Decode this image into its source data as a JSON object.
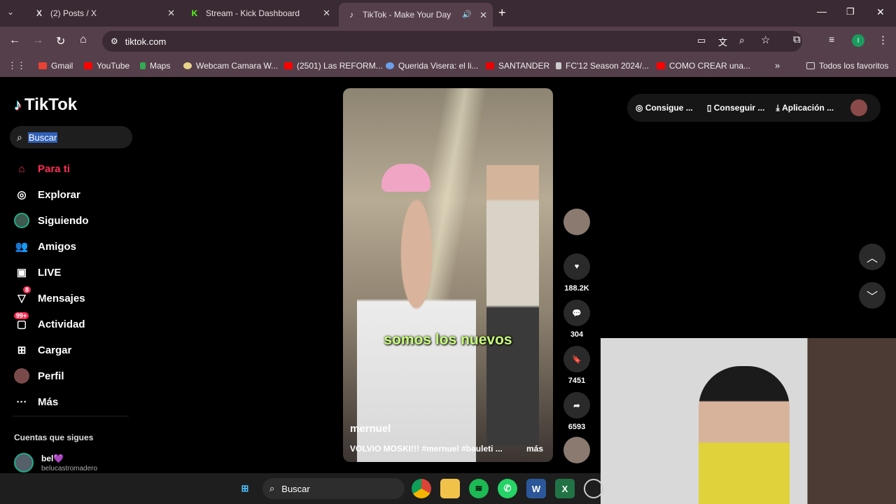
{
  "tabs": [
    {
      "title": "(2) Posts / X",
      "icon": "X"
    },
    {
      "title": "Stream - Kick Dashboard",
      "icon": "K"
    },
    {
      "title": "TikTok - Make Your Day",
      "icon": "♪"
    }
  ],
  "address": "tiktok.com",
  "bookmarks": [
    "Gmail",
    "YouTube",
    "Maps",
    "Webcam Camara W...",
    "(2501) Las REFORM...",
    "Querida Visera: el li...",
    "SANTANDER",
    "FC'12 Season 2024/...",
    "COMO CREAR una..."
  ],
  "bookmarks_all": "Todos los favoritos",
  "app": {
    "logo": "TikTok",
    "search_placeholder": "Buscar"
  },
  "nav": [
    {
      "label": "Para ti",
      "icon": "home-icon",
      "active": true
    },
    {
      "label": "Explorar",
      "icon": "compass-icon"
    },
    {
      "label": "Siguiendo",
      "icon": "following-avatar-icon"
    },
    {
      "label": "Amigos",
      "icon": "friends-icon"
    },
    {
      "label": "LIVE",
      "icon": "live-icon"
    },
    {
      "label": "Mensajes",
      "icon": "messages-icon",
      "badge": "8"
    },
    {
      "label": "Actividad",
      "icon": "activity-icon",
      "badge": "99+"
    },
    {
      "label": "Cargar",
      "icon": "upload-icon"
    },
    {
      "label": "Perfil",
      "icon": "profile-avatar-icon"
    },
    {
      "label": "Más",
      "icon": "more-icon"
    }
  ],
  "following": {
    "title": "Cuentas que sigues",
    "account_name": "bel💜",
    "account_handle": "belucastromadero"
  },
  "video": {
    "subtitle": "somos los nuevos",
    "author": "mernuel",
    "description": "VOLVIO MOSKI!!! #mernuel #bauleti ...",
    "more": "más"
  },
  "actions": {
    "likes": "188.2K",
    "comments": "304",
    "saves": "7451",
    "shares": "6593"
  },
  "top_buttons": [
    "Consigue ...",
    "Conseguir ...",
    "Aplicación ..."
  ],
  "taskbar": {
    "search": "Buscar"
  }
}
